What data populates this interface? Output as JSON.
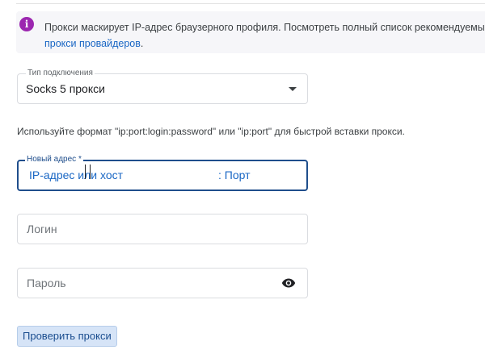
{
  "banner": {
    "text": "Прокси маскирует IP-адрес браузерного профиля. Посмотреть полный список рекомендуемых",
    "link": "прокси провайдеров",
    "link_suffix": "."
  },
  "connection_type": {
    "label": "Тип подключения",
    "value": "Socks 5 прокси"
  },
  "hint": "Используйте формат \"ip:port:login:password\" или \"ip:port\" для быстрой вставки прокси.",
  "address": {
    "label": "Новый адрес *",
    "host_placeholder": "IP-адрес или хост",
    "port_placeholder": ": Порт"
  },
  "login": {
    "placeholder": "Логин"
  },
  "password": {
    "placeholder": "Пароль"
  },
  "check_button": "Проверить прокси",
  "icons": {
    "info": "info-icon",
    "dropdown": "chevron-down-icon",
    "visibility": "eye-icon"
  },
  "colors": {
    "accent": "#1a67c4",
    "info_icon": "#9c27b0",
    "focus_border": "#1f4e8c",
    "button_bg": "#d6e4f7"
  }
}
